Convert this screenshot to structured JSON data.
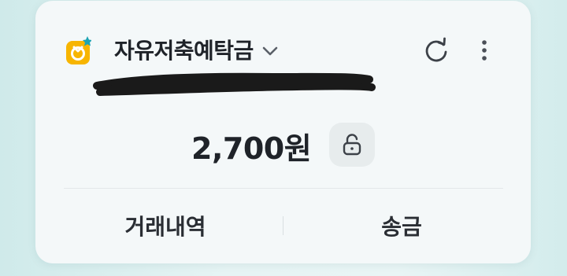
{
  "account": {
    "name": "자유저축예탁금",
    "number_line": "",
    "balance": "2,700원"
  },
  "icons": {
    "badge": "savings-medal-icon",
    "dropdown": "chevron-down-icon",
    "refresh": "refresh-icon",
    "more": "more-vertical-icon",
    "lock": "unlock-icon"
  },
  "actions": {
    "history_label": "거래내역",
    "transfer_label": "송금"
  },
  "colors": {
    "badge_yellow": "#f7b500",
    "badge_star": "#1ba3b3",
    "text_primary": "#1f2329",
    "card_bg": "#f4f8f9"
  }
}
